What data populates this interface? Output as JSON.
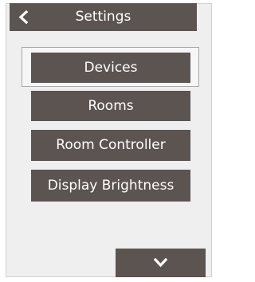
{
  "header": {
    "title": "Settings",
    "back_icon": "chevron-left-icon"
  },
  "menu": {
    "items": [
      {
        "label": "Devices",
        "selected": true
      },
      {
        "label": "Rooms",
        "selected": false
      },
      {
        "label": "Room Controller",
        "selected": false
      },
      {
        "label": "Display Brightness",
        "selected": false
      }
    ]
  },
  "footer": {
    "scroll_icon": "chevron-down-icon"
  },
  "colors": {
    "button_bg": "#5c5451",
    "panel_bg": "#efefef",
    "text": "#ffffff"
  }
}
